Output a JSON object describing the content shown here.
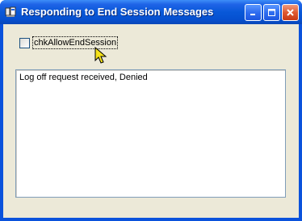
{
  "window": {
    "title": "Responding to End Session Messages"
  },
  "titlebar_buttons": {
    "minimize_icon": "minimize-icon",
    "maximize_icon": "maximize-icon",
    "close_icon": "close-icon"
  },
  "checkbox": {
    "label": "chkAllowEndSession",
    "checked": false
  },
  "log": {
    "text": "Log off request received, Denied"
  },
  "colors": {
    "titlebar": "#0858d8",
    "client_bg": "#ece9d8",
    "close_button": "#df5a32"
  }
}
